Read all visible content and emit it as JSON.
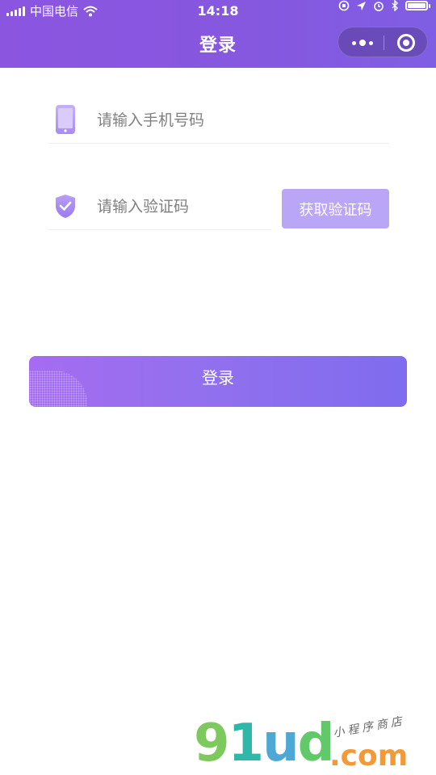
{
  "status_bar": {
    "carrier": "中国电信",
    "time": "14:18"
  },
  "nav": {
    "title": "登录"
  },
  "form": {
    "phone_placeholder": "请输入手机号码",
    "code_placeholder": "请输入验证码",
    "get_code_label": "获取验证码",
    "login_label": "登录"
  },
  "watermark": {
    "logo_text": "91ud",
    "logo_parts": [
      "9",
      "1",
      "u",
      "d"
    ],
    "domain": ".com",
    "tagline": "小程序商店"
  },
  "colors": {
    "header": "#8657df",
    "get_code_button": "#b9a6f6",
    "login_gradient_start": "#a56cf0",
    "login_gradient_end": "#7f6cee"
  }
}
